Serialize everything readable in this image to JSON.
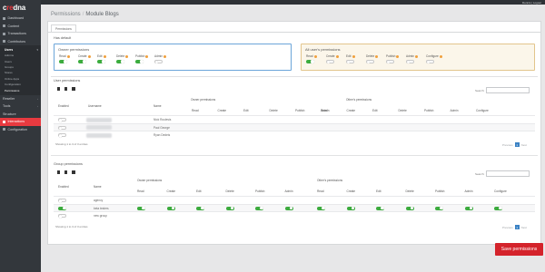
{
  "app": {
    "brand_a": "c",
    "brand_b": "re",
    "brand_c": "dna"
  },
  "topbar": {
    "links": "Dennis | Logout"
  },
  "sidebar": {
    "items": [
      {
        "label": "Dashboard"
      },
      {
        "label": "Content"
      },
      {
        "label": "Transactions"
      },
      {
        "label": "Contributors"
      }
    ],
    "sub_parent": "Users",
    "sub_items": [
      {
        "label": "Admins"
      },
      {
        "label": "Users"
      },
      {
        "label": "Groups"
      },
      {
        "label": "Stores"
      },
      {
        "label": "Online Apps"
      },
      {
        "label": "Configuration"
      },
      {
        "label": "Permissions"
      }
    ],
    "lower": [
      {
        "label": "Reseller"
      },
      {
        "label": "Tools"
      },
      {
        "label": "Structure"
      },
      {
        "label": "Interactions"
      },
      {
        "label": "Configuration"
      }
    ]
  },
  "page": {
    "crumb": "Permissions",
    "sep": "/",
    "current": "Module Blogs"
  },
  "panel": {
    "tab": "Permissions",
    "has_default": "Has default",
    "owner": {
      "title": "Owner permissions",
      "perms": [
        {
          "label": "Read",
          "on": true
        },
        {
          "label": "Create",
          "on": true
        },
        {
          "label": "Edit",
          "on": true
        },
        {
          "label": "Delete",
          "on": true
        },
        {
          "label": "Publish",
          "on": true
        },
        {
          "label": "Admin",
          "on": false
        }
      ]
    },
    "others": {
      "title": "All user's permissions",
      "perms": [
        {
          "label": "Read",
          "on": true
        },
        {
          "label": "Create",
          "on": false
        },
        {
          "label": "Edit",
          "on": false
        },
        {
          "label": "Delete",
          "on": false
        },
        {
          "label": "Publish",
          "on": false
        },
        {
          "label": "Admin",
          "on": false
        },
        {
          "label": "Configure",
          "on": false
        }
      ]
    },
    "user_section": {
      "title": "User permissions",
      "search_label": "Search:",
      "headers": {
        "enabled": "Enabled",
        "username": "Username",
        "name": "Name",
        "owner_group": "Owner permissions",
        "others_group": "Other's permissions"
      },
      "cols_owner": [
        "Read",
        "Create",
        "Edit",
        "Delete",
        "Publish",
        "Admin"
      ],
      "cols_others": [
        "Read",
        "Create",
        "Edit",
        "Delete",
        "Publish",
        "Admin",
        "Configure"
      ],
      "rows": [
        {
          "name": "Nick Roulesis"
        },
        {
          "name": "Paul George"
        },
        {
          "name": "Ryan Dedeis"
        }
      ],
      "info": "Showing 1 to 3 of 3 entries",
      "prev": "Previous",
      "page": "1",
      "next": "Next"
    },
    "group_section": {
      "title": "Group permissions",
      "search_label": "Search:",
      "headers": {
        "enabled": "Enabled",
        "name": "Name",
        "owner_group": "Owner permissions",
        "others_group": "Other's permissions"
      },
      "cols_owner": [
        "Read",
        "Create",
        "Edit",
        "Delete",
        "Publish",
        "Admin"
      ],
      "cols_others": [
        "Read",
        "Create",
        "Edit",
        "Delete",
        "Publish",
        "Admin",
        "Configure"
      ],
      "rows": [
        {
          "name": "agency",
          "enabled": false,
          "owner": [
            false,
            false,
            false,
            false,
            false,
            false
          ],
          "others": [
            false,
            false,
            false,
            false,
            false,
            false,
            false
          ]
        },
        {
          "name": "beta testers",
          "enabled": true,
          "owner": [
            true,
            true,
            true,
            true,
            true,
            true
          ],
          "others": [
            true,
            true,
            true,
            true,
            true,
            true,
            true
          ]
        },
        {
          "name": "new group",
          "enabled": false,
          "owner": [
            false,
            false,
            false,
            false,
            false,
            false
          ],
          "others": [
            false,
            false,
            false,
            false,
            false,
            false,
            false
          ]
        }
      ],
      "info": "Showing 1 to 3 of 3 entries",
      "prev": "Previous",
      "page": "1",
      "next": "Next"
    },
    "save_label": "Save permissions"
  }
}
